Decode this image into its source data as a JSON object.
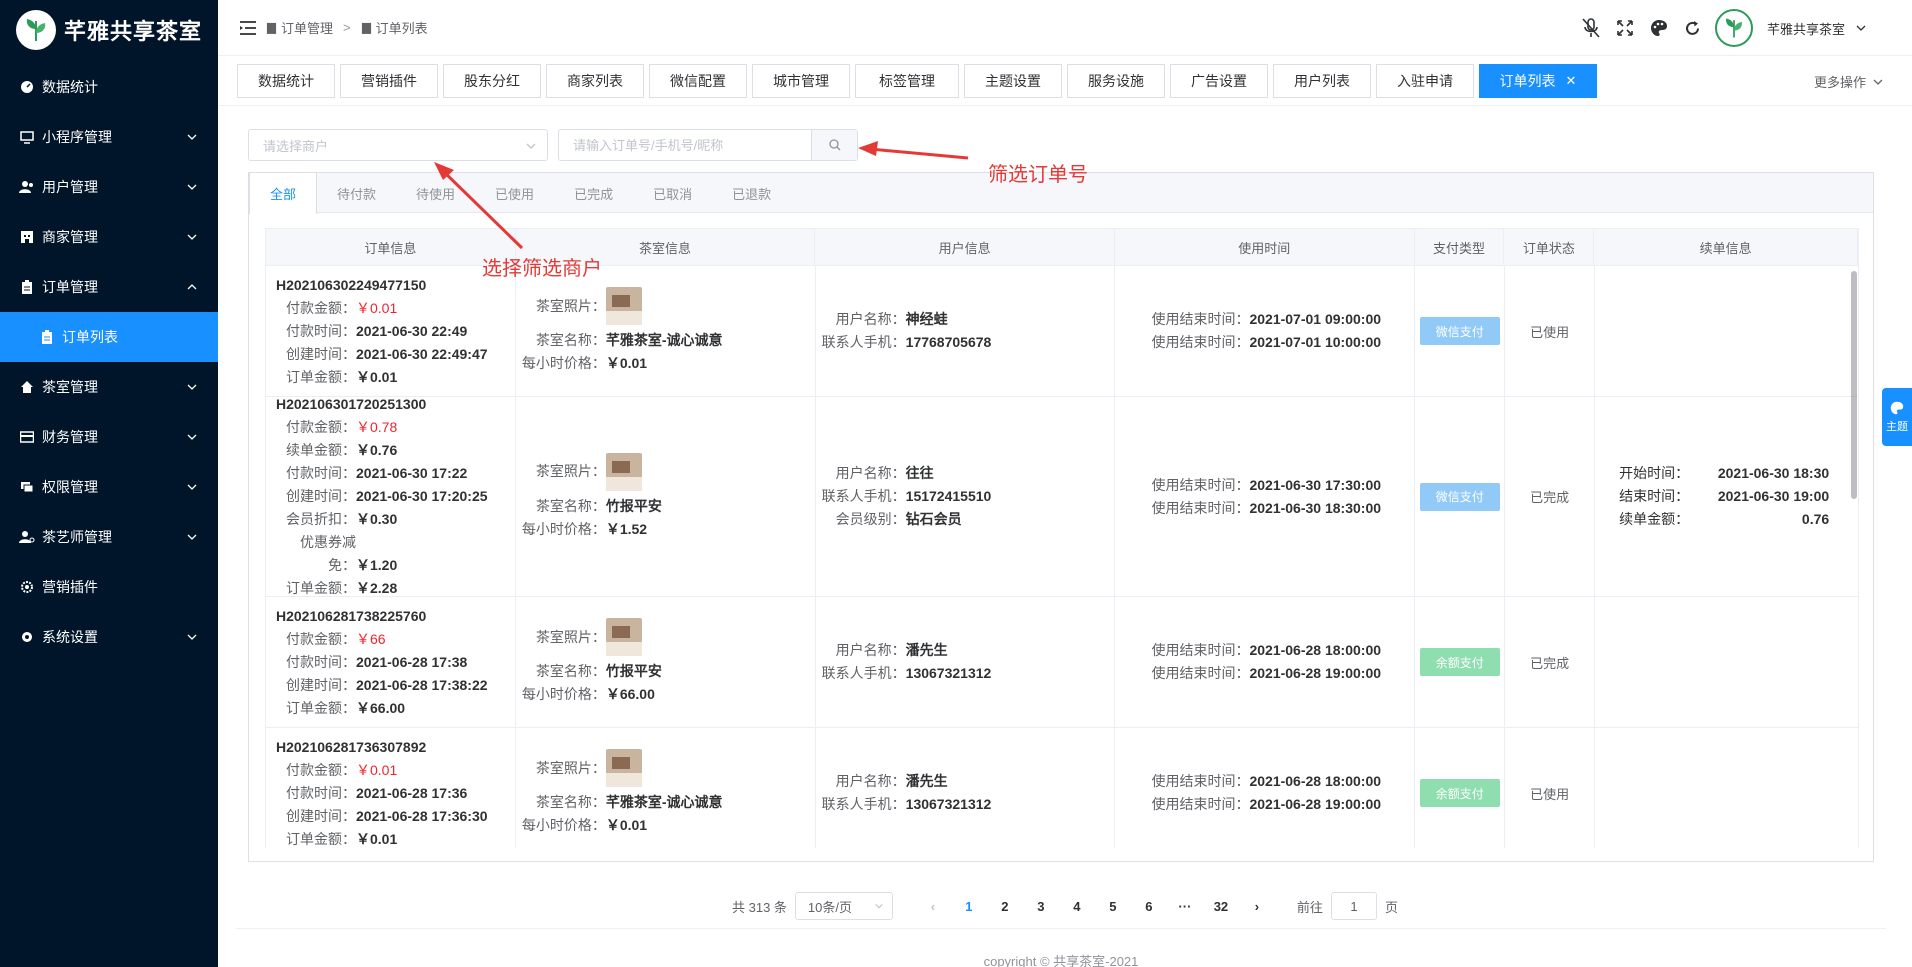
{
  "app": {
    "logo_text": "芊雅共享茶室",
    "username": "芊雅共享茶室"
  },
  "sidebar": {
    "items": [
      {
        "label": "数据统计"
      },
      {
        "label": "小程序管理"
      },
      {
        "label": "用户管理"
      },
      {
        "label": "商家管理"
      },
      {
        "label": "订单管理"
      },
      {
        "label": "订单列表"
      },
      {
        "label": "茶室管理"
      },
      {
        "label": "财务管理"
      },
      {
        "label": "权限管理"
      },
      {
        "label": "茶艺师管理"
      },
      {
        "label": "营销插件"
      },
      {
        "label": "系统设置"
      }
    ]
  },
  "breadcrumb": {
    "item1": "订单管理",
    "sep": ">",
    "item2": "订单列表"
  },
  "tabs": [
    "数据统计",
    "营销插件",
    "股东分红",
    "商家列表",
    "微信配置",
    "城市管理",
    "标签管理",
    "主题设置",
    "服务设施",
    "广告设置",
    "用户列表",
    "入驻申请",
    "订单列表"
  ],
  "more_ops": "更多操作",
  "filters": {
    "merchant_placeholder": "请选择商户",
    "search_placeholder": "请输入订单号/手机号/昵称"
  },
  "status_tabs": [
    "全部",
    "待付款",
    "待使用",
    "已使用",
    "已完成",
    "已取消",
    "已退款"
  ],
  "table": {
    "headers": [
      "订单信息",
      "茶室信息",
      "用户信息",
      "使用时间",
      "支付类型",
      "订单状态",
      "续单信息"
    ],
    "labels": {
      "pay_amount": "付款金额：",
      "pay_time": "付款时间：",
      "create_time": "创建时间：",
      "order_amount": "订单金额：",
      "renew_amount": "续单金额：",
      "member_discount": "会员折扣：",
      "coupon": "优惠券减免：",
      "room_photo": "茶室照片：",
      "room_name": "茶室名称：",
      "hour_price": "每小时价格：",
      "user_name": "用户名称：",
      "phone": "联系人手机：",
      "member_level": "会员级别：",
      "use_end": "使用结束时间：",
      "start_time": "开始时间：",
      "end_time": "结束时间：",
      "renew_amount2": "续单金额："
    },
    "rows": [
      {
        "order_id": "H202106302249477150",
        "pay_amount": "￥0.01",
        "pay_time": "2021-06-30 22:49",
        "create_time": "2021-06-30 22:49:47",
        "order_amount": "￥0.01",
        "room_name": "芊雅茶室-诚心诚意",
        "hour_price": "￥0.01",
        "user_name": "神经蛙",
        "phone": "17768705678",
        "use_time1": "2021-07-01 09:00:00",
        "use_time2": "2021-07-01 10:00:00",
        "pay_type": "微信支付",
        "status": "已使用"
      },
      {
        "order_id": "H202106301720251300",
        "pay_amount": "￥0.78",
        "renew_amount": "￥0.76",
        "pay_time": "2021-06-30 17:22",
        "create_time": "2021-06-30 17:20:25",
        "member_discount": "￥0.30",
        "coupon": "￥1.20",
        "order_amount": "￥2.28",
        "room_name": "竹报平安",
        "hour_price": "￥1.52",
        "user_name": "往往",
        "phone": "15172415510",
        "member_level": "钻石会员",
        "use_time1": "2021-06-30 17:30:00",
        "use_time2": "2021-06-30 18:30:00",
        "pay_type": "微信支付",
        "status": "已完成",
        "renew_start": "2021-06-30 18:30",
        "renew_end": "2021-06-30 19:00",
        "renew_total": "0.76"
      },
      {
        "order_id": "H202106281738225760",
        "pay_amount": "￥66",
        "pay_time": "2021-06-28 17:38",
        "create_time": "2021-06-28 17:38:22",
        "order_amount": "￥66.00",
        "room_name": "竹报平安",
        "hour_price": "￥66.00",
        "user_name": "潘先生",
        "phone": "13067321312",
        "use_time1": "2021-06-28 18:00:00",
        "use_time2": "2021-06-28 19:00:00",
        "pay_type": "余额支付",
        "status": "已完成"
      },
      {
        "order_id": "H202106281736307892",
        "pay_amount": "￥0.01",
        "pay_time": "2021-06-28 17:36",
        "create_time": "2021-06-28 17:36:30",
        "order_amount": "￥0.01",
        "room_name": "芊雅茶室-诚心诚意",
        "hour_price": "￥0.01",
        "user_name": "潘先生",
        "phone": "13067321312",
        "use_time1": "2021-06-28 18:00:00",
        "use_time2": "2021-06-28 19:00:00",
        "pay_type": "余额支付",
        "status": "已使用"
      }
    ]
  },
  "pagination": {
    "total": "共 313 条",
    "size": "10条/页",
    "pages": [
      "1",
      "2",
      "3",
      "4",
      "5",
      "6",
      "···",
      "32"
    ],
    "goto": "前往",
    "goto_val": "1",
    "page_unit": "页"
  },
  "copyright": "copyright © 共享茶室-2021",
  "theme_label": "主题",
  "annotations": {
    "filter_order": "筛选订单号",
    "filter_merchant": "选择筛选商户"
  },
  "colors": {
    "accent": "#1890ff",
    "sidebar_bg": "#001529",
    "wechat_pay": "#91caf7",
    "balance_pay": "#8fdeb0",
    "red": "#f5222d"
  }
}
